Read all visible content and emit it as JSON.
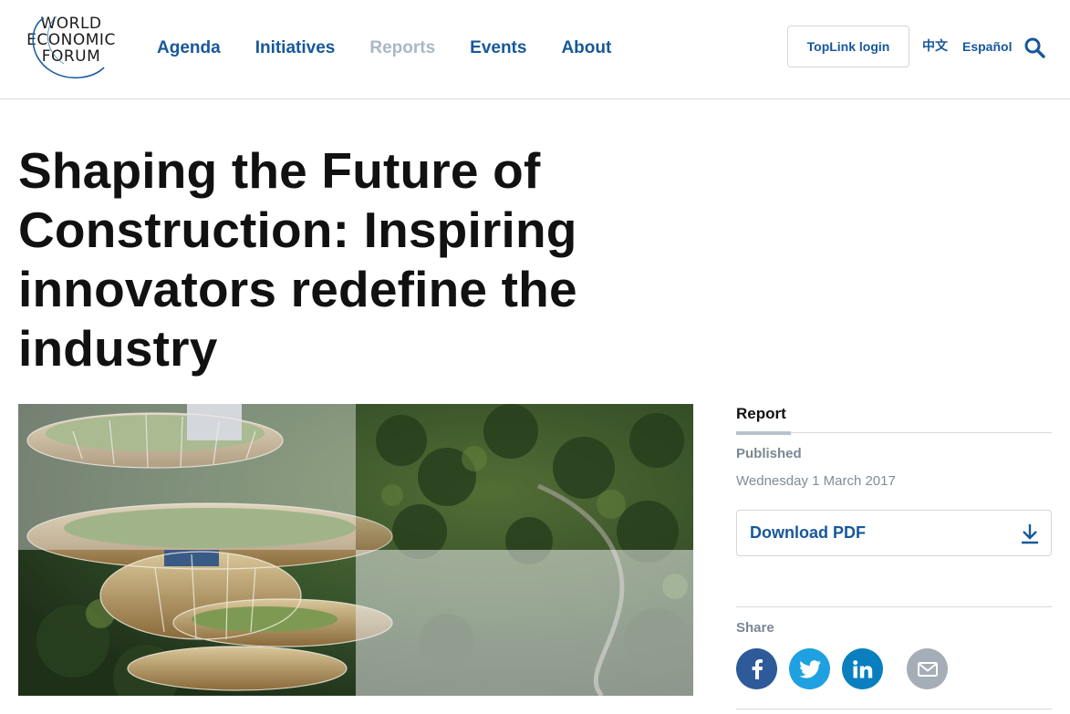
{
  "logo": {
    "line1": "WORLD",
    "line2": "ECONOMIC",
    "line3": "FORUM"
  },
  "nav": {
    "items": [
      {
        "label": "Agenda",
        "active": false
      },
      {
        "label": "Initiatives",
        "active": false
      },
      {
        "label": "Reports",
        "active": true
      },
      {
        "label": "Events",
        "active": false
      },
      {
        "label": "About",
        "active": false
      }
    ]
  },
  "header": {
    "toplink_label": "TopLink login",
    "lang_zh": "中文",
    "lang_es": "Español",
    "search_icon": "search-icon"
  },
  "article": {
    "title": "Shaping the Future of Construction: Inspiring innovators redefine the industry",
    "hero_image": "futuristic-spiral-tower-in-forest"
  },
  "sidebar": {
    "type_label": "Report",
    "published_label": "Published",
    "published_date": "Wednesday 1 March 2017",
    "download_label": "Download PDF",
    "download_icon": "download-icon",
    "share_label": "Share",
    "share_icons": [
      "facebook-icon",
      "twitter-icon",
      "linkedin-icon",
      "email-icon"
    ]
  },
  "colors": {
    "brand_blue": "#17589a",
    "nav_active": "#a9b8c6",
    "facebook": "#2e5a9a",
    "twitter": "#1fa0e0",
    "linkedin": "#0a7fbf",
    "email": "#a5adb6"
  }
}
